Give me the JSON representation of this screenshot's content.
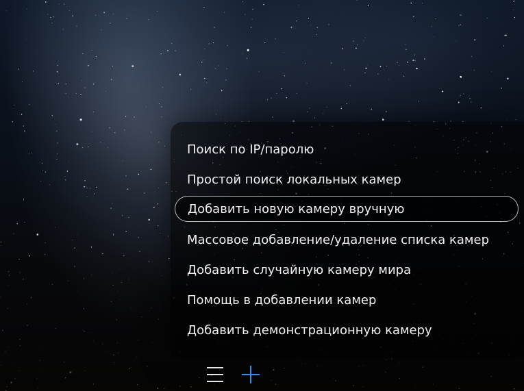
{
  "menu": {
    "items": [
      {
        "label": "Поиск по IP/паролю"
      },
      {
        "label": "Простой поиск локальных камер"
      },
      {
        "label": "Добавить новую камеру вручную",
        "selected": true
      },
      {
        "label": "Массовое добавление/удаление списка камер"
      },
      {
        "label": "Добавить случайную камеру мира"
      },
      {
        "label": "Помощь в добавлении камер"
      },
      {
        "label": "Добавить демонстрационную камеру"
      }
    ]
  },
  "toolbar": {
    "menu_icon": "hamburger-menu-icon",
    "add_icon": "plus-icon",
    "accent_color": "#2f8ff0"
  }
}
